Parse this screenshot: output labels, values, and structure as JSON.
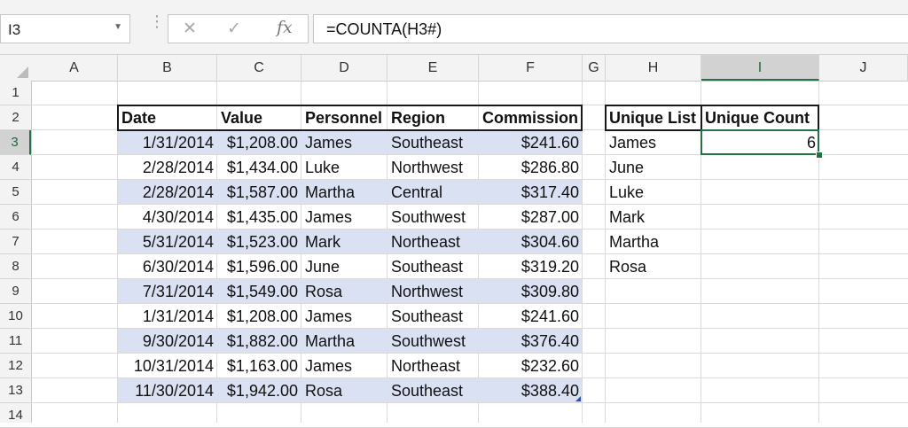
{
  "formula_bar": {
    "name_box": "I3",
    "formula": "=COUNTA(H3#)"
  },
  "icons": [
    "chevron-down-icon",
    "cancel-icon",
    "enter-icon",
    "fx-icon",
    "select-all-icon"
  ],
  "columns": [
    "A",
    "B",
    "C",
    "D",
    "E",
    "F",
    "G",
    "H",
    "I",
    "J"
  ],
  "rows": [
    "1",
    "2",
    "3",
    "4",
    "5",
    "6",
    "7",
    "8",
    "9",
    "10",
    "11",
    "12",
    "13",
    "14"
  ],
  "active_cell": "I3",
  "colors": {
    "band": "#d9e1f2",
    "active": "#217346"
  },
  "table": {
    "headers": [
      "Date",
      "Value",
      "Personnel",
      "Region",
      "Commission"
    ],
    "rows": [
      [
        "1/31/2014",
        "$1,208.00",
        "James",
        "Southeast",
        "$241.60"
      ],
      [
        "2/28/2014",
        "$1,434.00",
        "Luke",
        "Northwest",
        "$286.80"
      ],
      [
        "2/28/2014",
        "$1,587.00",
        "Martha",
        "Central",
        "$317.40"
      ],
      [
        "4/30/2014",
        "$1,435.00",
        "James",
        "Southwest",
        "$287.00"
      ],
      [
        "5/31/2014",
        "$1,523.00",
        "Mark",
        "Northeast",
        "$304.60"
      ],
      [
        "6/30/2014",
        "$1,596.00",
        "June",
        "Southeast",
        "$319.20"
      ],
      [
        "7/31/2014",
        "$1,549.00",
        "Rosa",
        "Northwest",
        "$309.80"
      ],
      [
        "1/31/2014",
        "$1,208.00",
        "James",
        "Southeast",
        "$241.60"
      ],
      [
        "9/30/2014",
        "$1,882.00",
        "Martha",
        "Southwest",
        "$376.40"
      ],
      [
        "10/31/2014",
        "$1,163.00",
        "James",
        "Northeast",
        "$232.60"
      ],
      [
        "11/30/2014",
        "$1,942.00",
        "Rosa",
        "Southeast",
        "$388.40"
      ]
    ]
  },
  "unique": {
    "list_header": "Unique List",
    "count_header": "Unique Count",
    "list": [
      "James",
      "June",
      "Luke",
      "Mark",
      "Martha",
      "Rosa"
    ],
    "count": "6"
  }
}
